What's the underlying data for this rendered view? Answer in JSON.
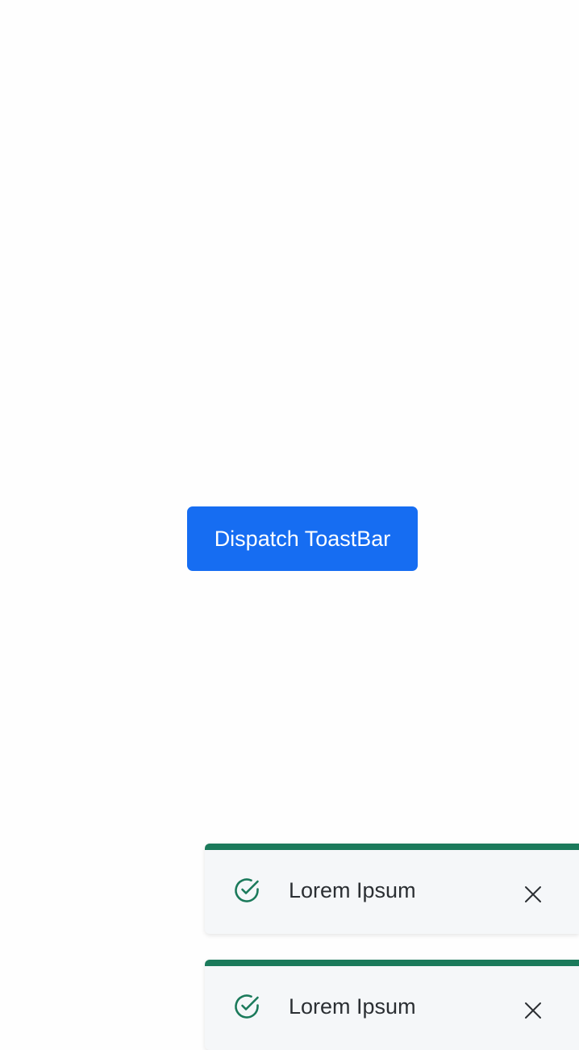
{
  "main": {
    "dispatch_button_label": "Dispatch ToastBar"
  },
  "toasts": [
    {
      "message": "Lorem Ipsum",
      "status": "success",
      "icon": "check-circle-icon",
      "close_icon": "close-icon"
    },
    {
      "message": "Lorem Ipsum",
      "status": "success",
      "icon": "check-circle-icon",
      "close_icon": "close-icon"
    }
  ],
  "colors": {
    "primary": "#166df2",
    "success": "#1b7a5b",
    "toast_background": "#f5f7f9",
    "text": "#2b2f33"
  }
}
